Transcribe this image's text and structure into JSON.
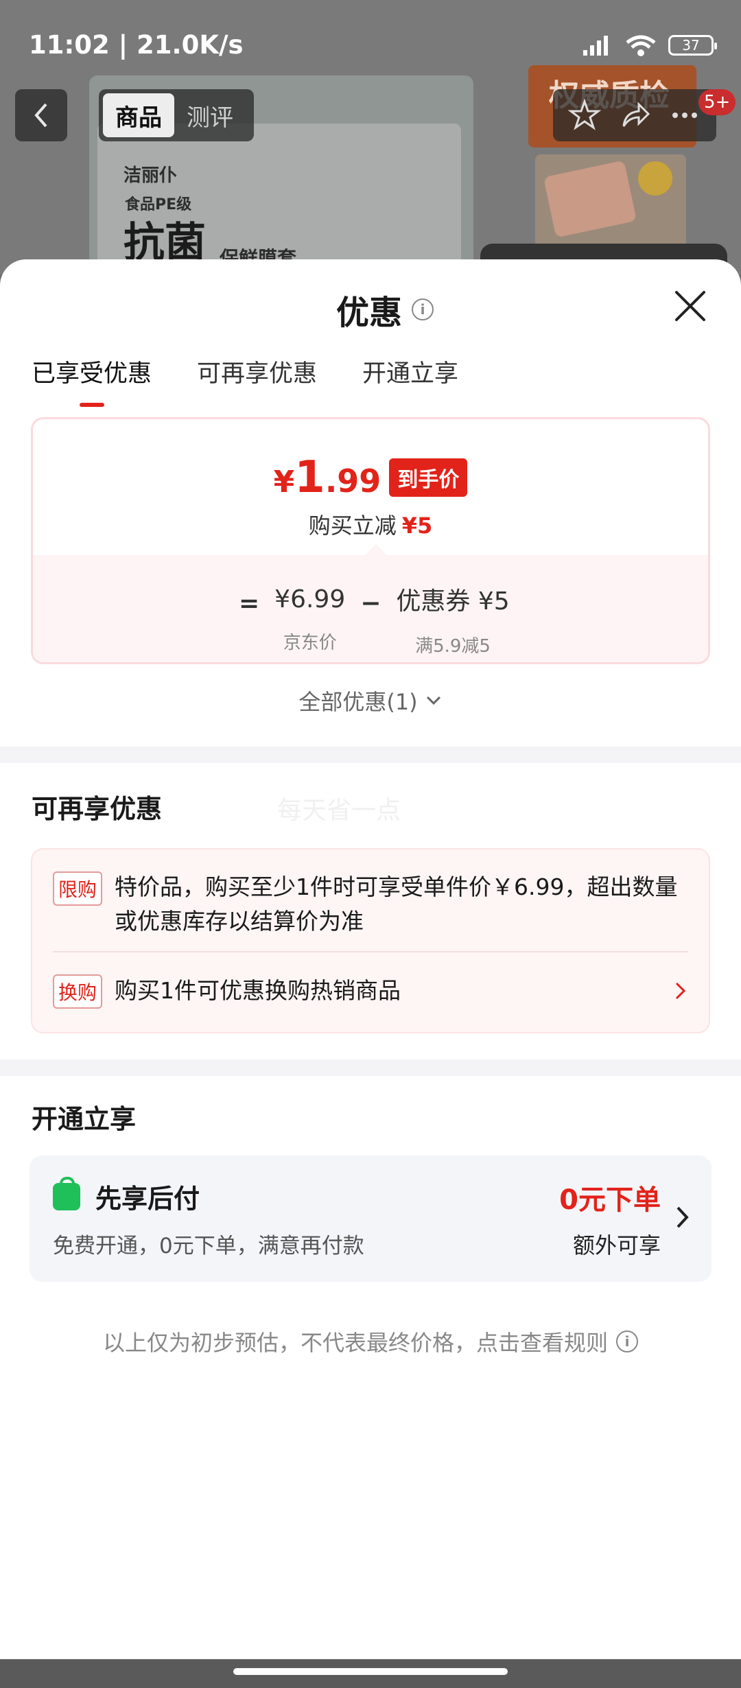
{
  "status_bar": {
    "time": "11:02 | 21.0K/s",
    "battery": "37"
  },
  "background": {
    "brand": "洁丽仆",
    "product_sub": "食品PE级",
    "product_big": "抗菌",
    "product_tag": "保鲜膜套",
    "side_banner": "权威质检"
  },
  "nav": {
    "tabs": [
      "商品",
      "测评"
    ],
    "badge": "5+"
  },
  "sheet": {
    "title": "优惠",
    "tabs": [
      "已享受优惠",
      "可再享优惠",
      "开通立享"
    ],
    "price_card": {
      "currency": "¥",
      "price_int": "1",
      "price_dec": ".99",
      "badge": "到手价",
      "save_label": "购买立减",
      "save_amount": "¥5",
      "eq": "=",
      "base_price": "¥6.99",
      "base_label": "京东价",
      "minus": "−",
      "coupon": "优惠券 ¥5",
      "coupon_label": "满5.9减5"
    },
    "all_discounts": "全部优惠(1)",
    "section2": {
      "title": "可再享优惠",
      "watermark": "每天省一点",
      "rows": [
        {
          "tag": "限购",
          "text": "特价品，购买至少1件时可享受单件价￥6.99，超出数量或优惠库存以结算价为准"
        },
        {
          "tag": "换购",
          "text": "购买1件可优惠换购热销商品"
        }
      ]
    },
    "section3": {
      "title": "开通立享",
      "card": {
        "title": "先享后付",
        "desc": "免费开通，0元下单，满意再付款",
        "price": "0元下单",
        "extra": "额外可享"
      }
    },
    "disclaimer": "以上仅为初步预估，不代表最终价格，点击查看规则"
  },
  "colors": {
    "accent": "#e2231a",
    "green": "#1fbf5a"
  }
}
